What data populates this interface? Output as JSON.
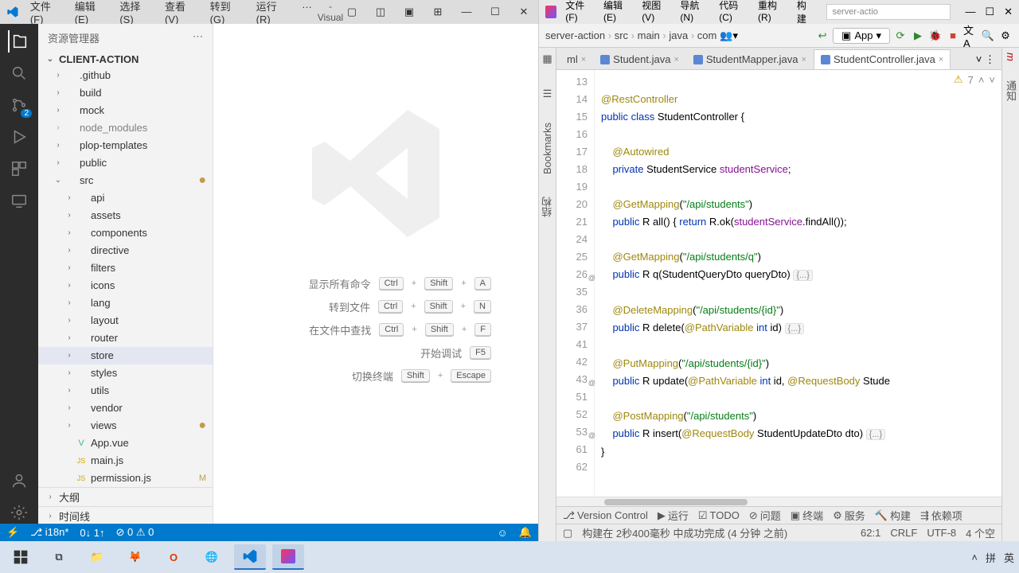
{
  "vscode": {
    "window_title": "client-action - Visual Studio Code",
    "menu": [
      "文件(F)",
      "编辑(E)",
      "选择(S)",
      "查看(V)",
      "转到(G)",
      "运行(R)",
      "…"
    ],
    "explorer_title": "资源管理器",
    "project_name": "CLIENT-ACTION",
    "tree": {
      "root": [
        {
          "name": ".github",
          "level": 1
        },
        {
          "name": "build",
          "level": 1
        },
        {
          "name": "mock",
          "level": 1
        },
        {
          "name": "node_modules",
          "level": 1,
          "dim": true
        },
        {
          "name": "plop-templates",
          "level": 1
        },
        {
          "name": "public",
          "level": 1
        },
        {
          "name": "src",
          "level": 1,
          "open": true,
          "mod": "dot"
        }
      ],
      "src": [
        {
          "name": "api",
          "level": 2
        },
        {
          "name": "assets",
          "level": 2
        },
        {
          "name": "components",
          "level": 2
        },
        {
          "name": "directive",
          "level": 2
        },
        {
          "name": "filters",
          "level": 2
        },
        {
          "name": "icons",
          "level": 2
        },
        {
          "name": "lang",
          "level": 2
        },
        {
          "name": "layout",
          "level": 2
        },
        {
          "name": "router",
          "level": 2
        },
        {
          "name": "store",
          "level": 2,
          "sel": true
        },
        {
          "name": "styles",
          "level": 2
        },
        {
          "name": "utils",
          "level": 2
        },
        {
          "name": "vendor",
          "level": 2
        },
        {
          "name": "views",
          "level": 2,
          "mod": "dot"
        },
        {
          "name": "App.vue",
          "level": 2,
          "file": "vue"
        },
        {
          "name": "main.js",
          "level": 2,
          "file": "js"
        },
        {
          "name": "permission.js",
          "level": 2,
          "file": "js",
          "mod": "M"
        }
      ]
    },
    "outline": "大纲",
    "timeline": "时间线",
    "welcome_cmds": [
      {
        "label": "显示所有命令",
        "keys": [
          "Ctrl",
          "Shift",
          "A"
        ]
      },
      {
        "label": "转到文件",
        "keys": [
          "Ctrl",
          "Shift",
          "N"
        ]
      },
      {
        "label": "在文件中查找",
        "keys": [
          "Ctrl",
          "Shift",
          "F"
        ]
      },
      {
        "label": "开始调试",
        "keys": [
          "F5"
        ]
      },
      {
        "label": "切换终端",
        "keys": [
          "Shift",
          "Escape"
        ]
      }
    ],
    "status": {
      "branch": "i18n*",
      "sync": "0↓ 1↑",
      "err": "0",
      "warn": "0"
    },
    "scm_badge": "2"
  },
  "idea": {
    "menu": [
      "文件(F)",
      "编辑(E)",
      "视图(V)",
      "导航(N)",
      "代码(C)",
      "重构(R)",
      "构建"
    ],
    "search_placeholder": "server-actio",
    "breadcrumbs": [
      "server-action",
      "src",
      "main",
      "java",
      "com"
    ],
    "run_config": "App",
    "tabs": [
      {
        "label": "ml",
        "close": true,
        "trail": true
      },
      {
        "label": "Student.java",
        "close": true
      },
      {
        "label": "StudentMapper.java",
        "close": true
      },
      {
        "label": "StudentController.java",
        "close": true,
        "active": true
      }
    ],
    "inspections": {
      "warn": "7"
    },
    "code_lines": [
      {
        "n": 13,
        "html": ""
      },
      {
        "n": 14,
        "html": "<span class='ann'>@RestController</span>"
      },
      {
        "n": 15,
        "html": "<span class='kw'>public class</span> <span class='typ'>StudentController</span> {"
      },
      {
        "n": 16,
        "html": ""
      },
      {
        "n": 17,
        "html": "    <span class='ann'>@Autowired</span>"
      },
      {
        "n": 18,
        "html": "    <span class='kw'>private</span> StudentService <span class='fld'>studentService</span>;"
      },
      {
        "n": 19,
        "html": ""
      },
      {
        "n": 20,
        "html": "    <span class='ann'>@GetMapping</span>(<span class='str'>\"/api/students\"</span>)"
      },
      {
        "n": 21,
        "html": "    <span class='kw'>public</span> R <span class='fn'>all</span>() { <span class='kw'>return</span> R.<span class='fn'>ok</span>(<span class='fld'>studentService</span>.findAll());"
      },
      {
        "n": 24,
        "html": ""
      },
      {
        "n": 25,
        "html": "    <span class='ann'>@GetMapping</span>(<span class='str'>\"/api/students/q\"</span>)"
      },
      {
        "n": 26,
        "html": "    <span class='kw'>public</span> R <span class='fn'>q</span>(StudentQueryDto queryDto) <span class='fold-box'>{...}</span>",
        "fold": "@"
      },
      {
        "n": 35,
        "html": ""
      },
      {
        "n": 36,
        "html": "    <span class='ann'>@DeleteMapping</span>(<span class='str'>\"/api/students/{id}\"</span>)"
      },
      {
        "n": 37,
        "html": "    <span class='kw'>public</span> R <span class='fn'>delete</span>(<span class='ann'>@PathVariable</span> <span class='kw'>int</span> id) <span class='fold-box'>{...}</span>"
      },
      {
        "n": 41,
        "html": ""
      },
      {
        "n": 42,
        "html": "    <span class='ann'>@PutMapping</span>(<span class='str'>\"/api/students/{id}\"</span>)"
      },
      {
        "n": 43,
        "html": "    <span class='kw'>public</span> R <span class='fn'>update</span>(<span class='ann'>@PathVariable</span> <span class='kw'>int</span> id, <span class='ann'>@RequestBody</span> Stude",
        "fold": "@"
      },
      {
        "n": 51,
        "html": ""
      },
      {
        "n": 52,
        "html": "    <span class='ann'>@PostMapping</span>(<span class='str'>\"/api/students\"</span>)"
      },
      {
        "n": 53,
        "html": "    <span class='kw'>public</span> R <span class='fn'>insert</span>(<span class='ann'>@RequestBody</span> StudentUpdateDto dto) <span class='fold-box'>{...}</span>",
        "fold": "@"
      },
      {
        "n": 61,
        "html": "}"
      },
      {
        "n": 62,
        "html": ""
      }
    ],
    "bottom_tabs": [
      "Version Control",
      "运行",
      "TODO",
      "问题",
      "终端",
      "服务",
      "构建",
      "依赖项"
    ],
    "status": {
      "build": "构建在 2秒400毫秒 中成功完成 (4 分钟 之前)",
      "pos": "62:1",
      "eol": "CRLF",
      "enc": "UTF-8",
      "spaces": "4 个空"
    },
    "left_tools": [
      "项目",
      "Bookmarks",
      "结构"
    ],
    "right_tools": [
      "m",
      "通知"
    ]
  },
  "taskbar": {
    "tray": {
      "ime1": "拼",
      "ime2": "英"
    }
  }
}
